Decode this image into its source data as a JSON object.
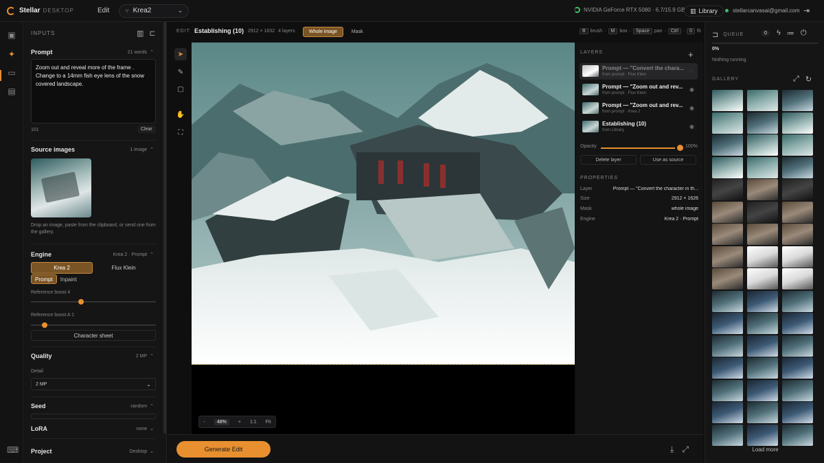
{
  "app": {
    "name": "Stellar",
    "subtitle": "DESKTOP",
    "menu_edit": "Edit",
    "model": "Krea2"
  },
  "system": {
    "gpu": "NVIDIA GeForce RTX 5080 · 6.7/15.9 GB",
    "library_label": "Library",
    "user_email": "stellarcanvasai@gmail.com"
  },
  "inputs": {
    "header": "INPUTS",
    "prompt": {
      "title": "Prompt",
      "meta": "21 words",
      "text": "Zoom out and reveal more of the frame . Change to a 14mm fish eye lens of the snow covered landscape.",
      "char_count": "101",
      "clear_label": "Clear"
    },
    "source_images": {
      "title": "Source images",
      "meta": "1 image",
      "hint": "Drop an image, paste from the clipboard, or send one from the gallery."
    },
    "engine": {
      "title": "Engine",
      "meta": "Krea 2 · Prompt",
      "options": [
        "Krea 2",
        "Flux Klein"
      ],
      "modes": [
        "Prompt",
        "Inpaint"
      ],
      "ref_boost_label": "Reference boost 4",
      "ref_boost_value": 4,
      "ref_boost_a_label": "Reference boost A 1",
      "ref_boost_a_value": 1,
      "character_sheet": "Character sheet"
    },
    "quality": {
      "title": "Quality",
      "meta": "2 MP",
      "detail_label": "Detail",
      "detail_value": "2 MP"
    },
    "seed": {
      "title": "Seed",
      "meta": "random"
    },
    "lora": {
      "title": "LoRA",
      "meta": "none"
    },
    "project": {
      "title": "Project",
      "meta": "Desktop"
    }
  },
  "edit": {
    "tag": "EDIT",
    "title": "Establishing (10)",
    "size": "2912 × 1632",
    "layers_count": "4 layers",
    "modes": [
      "Whole image",
      "Mask"
    ],
    "shortcuts": {
      "k1": "B",
      "t1": "brush",
      "k2": "M",
      "t2": "box",
      "k3": "Space",
      "t3": "pan",
      "k4": "Ctrl",
      "k4b": "0",
      "t4": "fit",
      "sep": "·"
    },
    "zoom": {
      "minus": "-",
      "value": "48%",
      "plus": "+",
      "one": "1:1",
      "fit": "Fit"
    },
    "generate_label": "Generate Edit"
  },
  "layers": {
    "header": "LAYERS",
    "items": [
      {
        "title": "Prompt — \"Convert the chara...",
        "sub": "from prompt · Flux Klein"
      },
      {
        "title": "Prompt — \"Zoom out and rev...",
        "sub": "from prompt · Flux Klein"
      },
      {
        "title": "Prompt — \"Zoom out and rev...",
        "sub": "from prompt · Krea 2"
      },
      {
        "title": "Establishing (10)",
        "sub": "from Library"
      }
    ],
    "opacity_label": "Opacity",
    "opacity_value": "100%",
    "delete_label": "Delete layer",
    "use_source_label": "Use as source"
  },
  "properties": {
    "header": "PROPERTIES",
    "rows": [
      {
        "k": "Layer",
        "v": "Prompt — \"Convert the character in th..."
      },
      {
        "k": "Size",
        "v": "2912 × 1626"
      },
      {
        "k": "Mask",
        "v": "whole image"
      },
      {
        "k": "Engine",
        "v": "Krea 2 · Prompt"
      }
    ]
  },
  "queue": {
    "header": "QUEUE",
    "count": "0",
    "progress": "0%",
    "status": "Nothing running."
  },
  "gallery": {
    "header": "GALLERY",
    "load_more": "Load more"
  },
  "icons": {
    "logo": "stellar-logo-icon",
    "chevron": "chevron-down-icon",
    "eye": "eye-icon"
  }
}
